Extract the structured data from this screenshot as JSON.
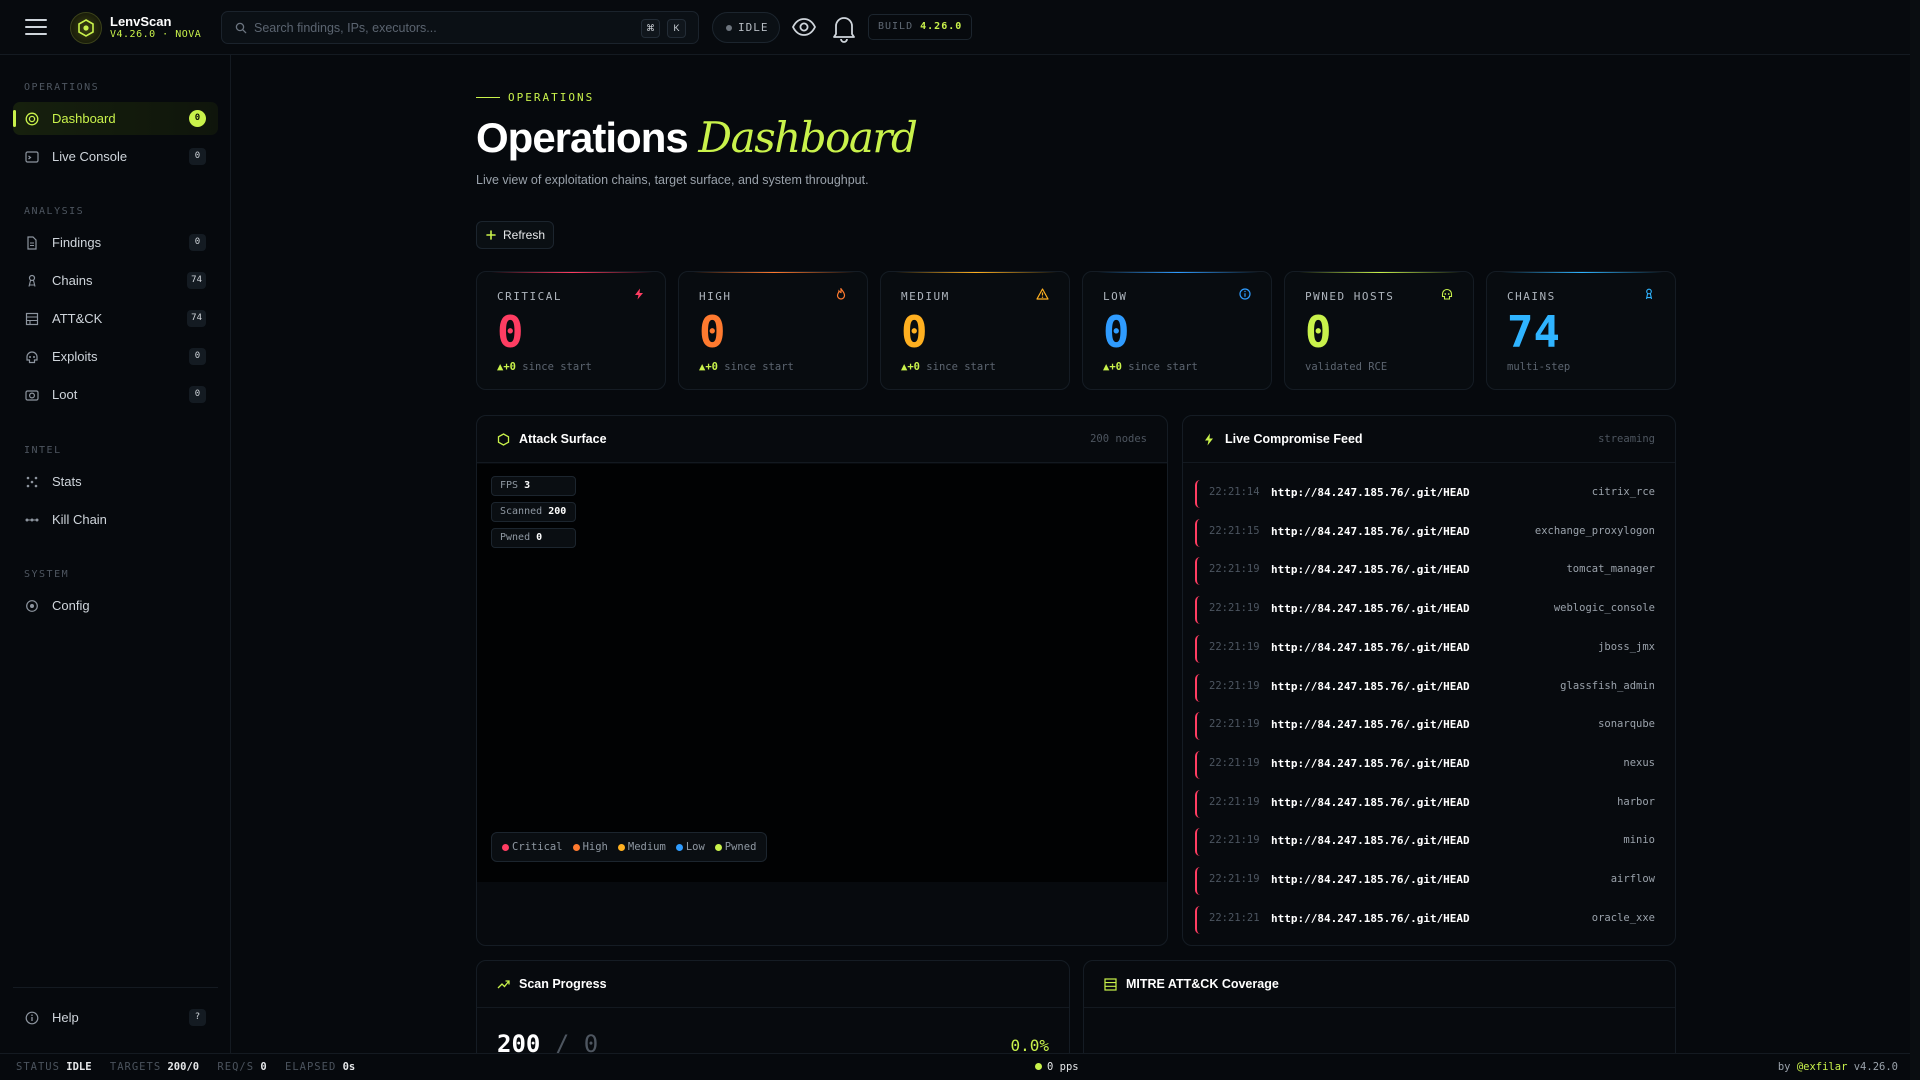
{
  "app": {
    "name": "LenvScan",
    "version_line": "V4.26.0 · NOVA"
  },
  "search": {
    "placeholder": "Search findings, IPs, executors...",
    "kbd": [
      "⌘",
      "K"
    ]
  },
  "status_pill": "IDLE",
  "build": {
    "label": "BUILD",
    "value": "4.26.0"
  },
  "sidebar": {
    "sections": {
      "operations": "OPERATIONS",
      "analysis": "ANALYSIS",
      "intel": "INTEL",
      "system": "SYSTEM"
    },
    "items": [
      {
        "label": "Dashboard",
        "count": "0",
        "icon": "target-icon"
      },
      {
        "label": "Live Console",
        "count": "0",
        "icon": "terminal-icon"
      },
      {
        "label": "Findings",
        "count": "0",
        "icon": "document-icon"
      },
      {
        "label": "Chains",
        "count": "74",
        "icon": "chain-icon"
      },
      {
        "label": "ATT&CK",
        "count": "74",
        "icon": "matrix-icon"
      },
      {
        "label": "Exploits",
        "count": "0",
        "icon": "skull-icon"
      },
      {
        "label": "Loot",
        "count": "0",
        "icon": "camera-icon"
      },
      {
        "label": "Stats",
        "icon": "scatter-icon"
      },
      {
        "label": "Kill Chain",
        "icon": "kill-chain-icon"
      },
      {
        "label": "Config",
        "icon": "gear-icon"
      }
    ],
    "help": {
      "label": "Help",
      "shortcut": "?"
    }
  },
  "page": {
    "eyebrow": "OPERATIONS",
    "title_main": "Operations",
    "title_accent": "Dashboard",
    "subtitle": "Live view of exploitation chains, target surface, and system throughput.",
    "refresh_label": "Refresh"
  },
  "stats": [
    {
      "label": "CRITICAL",
      "value": "0",
      "delta": "▲+0",
      "sub": "since start",
      "color": "#ff3d62",
      "icon": "bolt-icon"
    },
    {
      "label": "HIGH",
      "value": "0",
      "delta": "▲+0",
      "sub": "since start",
      "color": "#ff7a2f",
      "icon": "flame-icon"
    },
    {
      "label": "MEDIUM",
      "value": "0",
      "delta": "▲+0",
      "sub": "since start",
      "color": "#ffb020",
      "icon": "warning-icon"
    },
    {
      "label": "LOW",
      "value": "0",
      "delta": "▲+0",
      "sub": "since start",
      "color": "#2f9cff",
      "icon": "info-icon"
    },
    {
      "label": "PWNED HOSTS",
      "value": "0",
      "delta": "",
      "sub": "validated RCE",
      "color": "#c9f24b",
      "icon": "skull-icon"
    },
    {
      "label": "CHAINS",
      "value": "74",
      "delta": "",
      "sub": "multi-step",
      "color": "#2fb4ff",
      "icon": "chain-icon"
    }
  ],
  "attack_surface": {
    "title": "Attack Surface",
    "meta": "200 nodes",
    "chips": [
      {
        "k": "FPS",
        "v": "3"
      },
      {
        "k": "Scanned",
        "v": "200"
      },
      {
        "k": "Pwned",
        "v": "0"
      }
    ],
    "legend": [
      {
        "label": "Critical",
        "color": "#ff3d62"
      },
      {
        "label": "High",
        "color": "#ff7a2f"
      },
      {
        "label": "Medium",
        "color": "#ffb020"
      },
      {
        "label": "Low",
        "color": "#2f9cff"
      },
      {
        "label": "Pwned",
        "color": "#c9f24b"
      }
    ]
  },
  "feed": {
    "title": "Live Compromise Feed",
    "meta": "streaming",
    "rows": [
      {
        "time": "22:21:14",
        "url": "http://84.247.185.76/.git/HEAD",
        "module": "citrix_rce"
      },
      {
        "time": "22:21:15",
        "url": "http://84.247.185.76/.git/HEAD",
        "module": "exchange_proxylogon"
      },
      {
        "time": "22:21:19",
        "url": "http://84.247.185.76/.git/HEAD",
        "module": "tomcat_manager"
      },
      {
        "time": "22:21:19",
        "url": "http://84.247.185.76/.git/HEAD",
        "module": "weblogic_console"
      },
      {
        "time": "22:21:19",
        "url": "http://84.247.185.76/.git/HEAD",
        "module": "jboss_jmx"
      },
      {
        "time": "22:21:19",
        "url": "http://84.247.185.76/.git/HEAD",
        "module": "glassfish_admin"
      },
      {
        "time": "22:21:19",
        "url": "http://84.247.185.76/.git/HEAD",
        "module": "sonarqube"
      },
      {
        "time": "22:21:19",
        "url": "http://84.247.185.76/.git/HEAD",
        "module": "nexus"
      },
      {
        "time": "22:21:19",
        "url": "http://84.247.185.76/.git/HEAD",
        "module": "harbor"
      },
      {
        "time": "22:21:19",
        "url": "http://84.247.185.76/.git/HEAD",
        "module": "minio"
      },
      {
        "time": "22:21:19",
        "url": "http://84.247.185.76/.git/HEAD",
        "module": "airflow"
      },
      {
        "time": "22:21:21",
        "url": "http://84.247.185.76/.git/HEAD",
        "module": "oracle_xxe"
      }
    ]
  },
  "scan_progress": {
    "title": "Scan Progress",
    "done": "200",
    "sep": "/",
    "total": "0",
    "percent": "0.0%"
  },
  "mitre": {
    "title": "MITRE ATT&CK Coverage"
  },
  "statusbar": {
    "status_k": "STATUS",
    "status_v": "IDLE",
    "targets_k": "TARGETS",
    "targets_v": "200/0",
    "reqs_k": "REQ/S",
    "reqs_v": "0",
    "elapsed_k": "ELAPSED",
    "elapsed_v": "0s",
    "pps": "0 pps",
    "by": "by",
    "handle": "@exfilar",
    "version": "v4.26.0"
  }
}
